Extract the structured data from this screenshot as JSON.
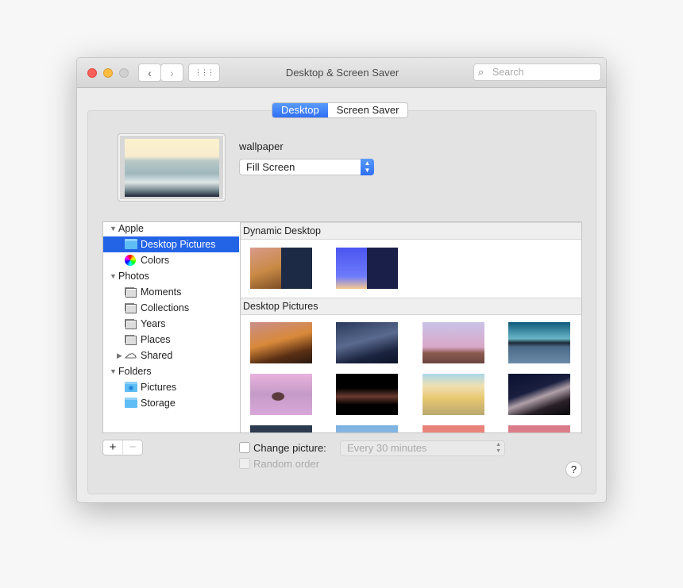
{
  "window": {
    "title": "Desktop & Screen Saver",
    "search_placeholder": "Search"
  },
  "toolbar": {
    "back": "‹",
    "forward": "›",
    "grid": "⋮⋮⋮"
  },
  "tabs": [
    {
      "label": "Desktop",
      "active": true
    },
    {
      "label": "Screen Saver",
      "active": false
    }
  ],
  "current": {
    "name": "wallpaper",
    "fit": "Fill Screen"
  },
  "sidebar": {
    "items": [
      {
        "label": "Apple",
        "type": "group",
        "expanded": true
      },
      {
        "label": "Desktop Pictures",
        "type": "folder",
        "selected": true
      },
      {
        "label": "Colors",
        "type": "colors"
      },
      {
        "label": "Photos",
        "type": "group",
        "expanded": true
      },
      {
        "label": "Moments",
        "type": "album"
      },
      {
        "label": "Collections",
        "type": "album"
      },
      {
        "label": "Years",
        "type": "album"
      },
      {
        "label": "Places",
        "type": "album"
      },
      {
        "label": "Shared",
        "type": "cloud",
        "expanded": false
      },
      {
        "label": "Folders",
        "type": "group",
        "expanded": true
      },
      {
        "label": "Pictures",
        "type": "folder-photo"
      },
      {
        "label": "Storage",
        "type": "folder"
      }
    ]
  },
  "sections": [
    {
      "title": "Dynamic Desktop"
    },
    {
      "title": "Desktop Pictures"
    }
  ],
  "footer": {
    "add": "+",
    "remove": "−",
    "change_picture": "Change picture:",
    "change_checked": false,
    "interval": "Every 30 minutes",
    "random_order": "Random order",
    "random_checked": false,
    "help": "?"
  },
  "colors": {
    "accent": "#2363e6",
    "close": "#fc605b",
    "minimize": "#fdbc40",
    "zoom": "#cfcfcf"
  }
}
